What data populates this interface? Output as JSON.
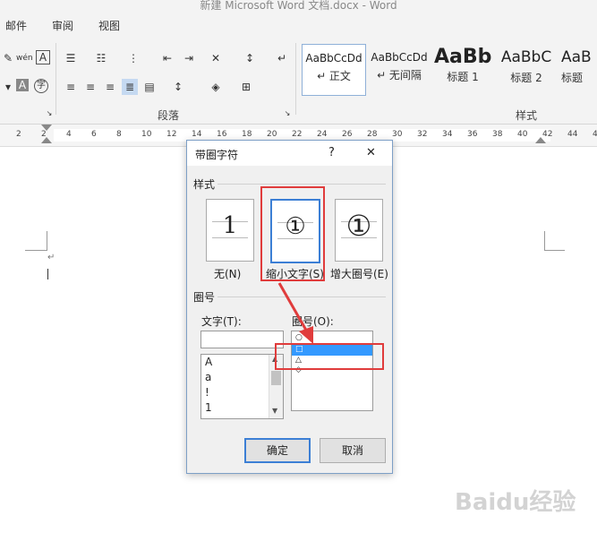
{
  "window": {
    "title": "新建 Microsoft Word 文档.docx - Word"
  },
  "ribbon_tabs": [
    {
      "label": "邮件"
    },
    {
      "label": "审阅"
    },
    {
      "label": "视图"
    }
  ],
  "ribbon": {
    "paragraph_group_label": "段落",
    "styles_group_label": "样式",
    "styles": [
      {
        "sample": "AaBbCcDd",
        "name": "↵ 正文"
      },
      {
        "sample": "AaBbCcDd",
        "name": "↵ 无间隔"
      },
      {
        "sample": "AaBb",
        "name": "标题 1"
      },
      {
        "sample": "AaBbC",
        "name": "标题 2"
      },
      {
        "sample": "AaB",
        "name": "标题"
      }
    ]
  },
  "ruler": {
    "ticks": [
      "2",
      "2",
      "4",
      "6",
      "8",
      "10",
      "12",
      "14",
      "16",
      "18",
      "20",
      "22",
      "24",
      "26",
      "28",
      "30",
      "32",
      "34",
      "36",
      "38",
      "40",
      "42",
      "44",
      "4"
    ]
  },
  "dialog": {
    "title": "带圈字符",
    "help": "?",
    "close": "✕",
    "style_section": "样式",
    "styles": [
      {
        "glyph": "1",
        "label": "无(N)"
      },
      {
        "glyph": "①",
        "label": "缩小文字(S)"
      },
      {
        "glyph": "①",
        "label": "增大圈号(E)"
      }
    ],
    "circle_section": "圈号",
    "text_label": "文字(T):",
    "text_value": "",
    "text_items": [
      "A",
      "a",
      "!",
      "1"
    ],
    "circle_label": "圈号(O):",
    "circle_items": [
      "○",
      "□",
      "△",
      "◇"
    ],
    "circle_selected": 1,
    "ok_label": "确定",
    "cancel_label": "取消"
  },
  "watermark": {
    "text": "Baidu经验"
  }
}
